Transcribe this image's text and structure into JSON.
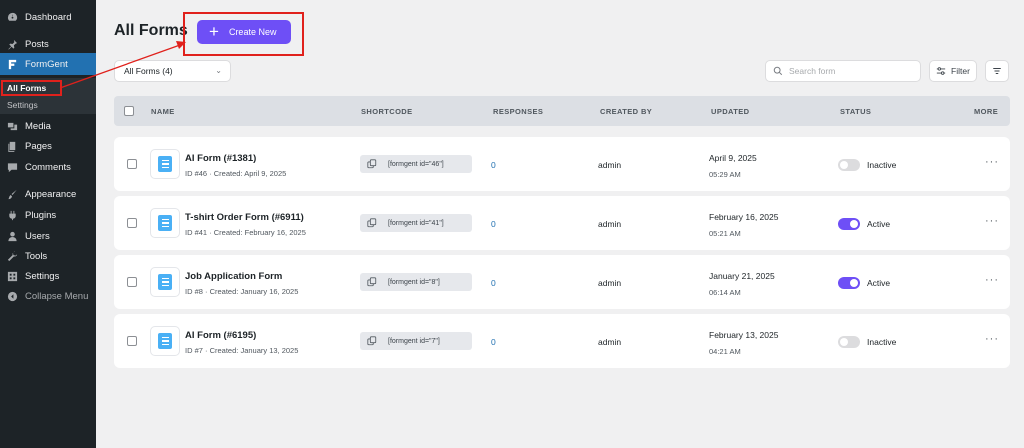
{
  "sidebar": {
    "items": [
      {
        "label": "Dashboard",
        "icon": "dashboard-icon"
      },
      {
        "label": "Posts",
        "icon": "pin-icon"
      },
      {
        "label": "FormGent",
        "icon": "formgent-icon"
      },
      {
        "label": "Media",
        "icon": "media-icon"
      },
      {
        "label": "Pages",
        "icon": "pages-icon"
      },
      {
        "label": "Comments",
        "icon": "comments-icon"
      },
      {
        "label": "Appearance",
        "icon": "brush-icon"
      },
      {
        "label": "Plugins",
        "icon": "plugin-icon"
      },
      {
        "label": "Users",
        "icon": "user-icon"
      },
      {
        "label": "Tools",
        "icon": "wrench-icon"
      },
      {
        "label": "Settings",
        "icon": "settings-icon"
      },
      {
        "label": "Collapse Menu",
        "icon": "collapse-icon"
      }
    ],
    "submenu": {
      "all_forms": "All Forms",
      "settings": "Settings"
    }
  },
  "header": {
    "title": "All Forms",
    "create_label": "Create New"
  },
  "toolbar": {
    "filter_select": "All Forms (4)",
    "search_placeholder": "Search form",
    "filter_label": "Filter"
  },
  "table": {
    "columns": [
      "NAME",
      "SHORTCODE",
      "RESPONSES",
      "CREATED BY",
      "UPDATED",
      "STATUS",
      "MORE"
    ],
    "rows": [
      {
        "name": "AI Form (#1381)",
        "meta": "ID #46 · Created: April 9, 2025",
        "shortcode": "[formgent id=\"46\"]",
        "responses": "0",
        "created_by": "admin",
        "updated_date": "April 9, 2025",
        "updated_time": "05:29 AM",
        "status": "Inactive",
        "active": false
      },
      {
        "name": "T-shirt Order Form (#6911)",
        "meta": "ID #41 · Created: February 16, 2025",
        "shortcode": "[formgent id=\"41\"]",
        "responses": "0",
        "created_by": "admin",
        "updated_date": "February 16, 2025",
        "updated_time": "05:21 AM",
        "status": "Active",
        "active": true
      },
      {
        "name": "Job Application Form",
        "meta": "ID #8 · Created: January 16, 2025",
        "shortcode": "[formgent id=\"8\"]",
        "responses": "0",
        "created_by": "admin",
        "updated_date": "January 21, 2025",
        "updated_time": "06:14 AM",
        "status": "Active",
        "active": true
      },
      {
        "name": "AI Form (#6195)",
        "meta": "ID #7 · Created: January 13, 2025",
        "shortcode": "[formgent id=\"7\"]",
        "responses": "0",
        "created_by": "admin",
        "updated_date": "February 13, 2025",
        "updated_time": "04:21 AM",
        "status": "Inactive",
        "active": false
      }
    ]
  },
  "colors": {
    "accent": "#6e4ff6",
    "sidebar_bg": "#1d2327",
    "active_menu": "#2271b1",
    "highlight": "#e0211c",
    "form_icon": "#4ab0f5"
  }
}
